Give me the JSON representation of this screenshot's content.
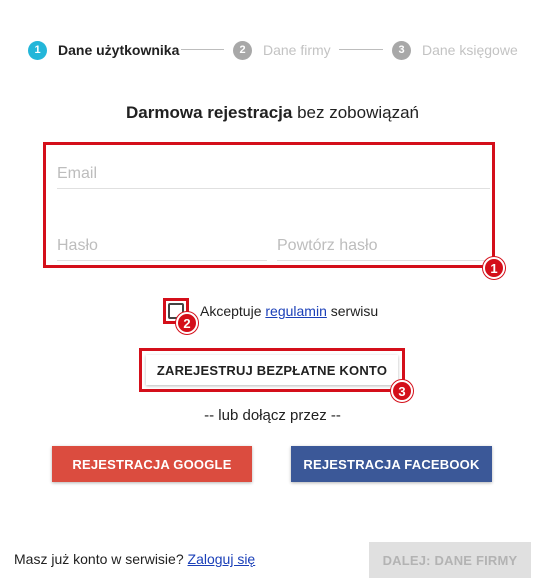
{
  "stepper": {
    "steps": [
      {
        "number": "1",
        "label": "Dane użytkownika",
        "state": "active"
      },
      {
        "number": "2",
        "label": "Dane firmy",
        "state": "inactive"
      },
      {
        "number": "3",
        "label": "Dane księgowe",
        "state": "inactive"
      }
    ]
  },
  "title": {
    "bold": "Darmowa rejestracja",
    "rest": " bez zobowiązań"
  },
  "form": {
    "email_placeholder": "Email",
    "password_placeholder": "Hasło",
    "repeat_password_placeholder": "Powtórz hasło"
  },
  "annotations": {
    "badge1": "1",
    "badge2": "2",
    "badge3": "3"
  },
  "terms": {
    "prefix": "Akceptuje ",
    "link": "regulamin",
    "suffix": " serwisu"
  },
  "register_button": "ZAREJESTRUJ BEZPŁATNE KONTO",
  "or_text": "-- lub dołącz przez --",
  "social": {
    "google": "REJESTRACJA GOOGLE",
    "facebook": "REJESTRACJA FACEBOOK"
  },
  "footer": {
    "text": "Masz już konto w serwisie? ",
    "login_link": "Zaloguj się",
    "next_button": "DALEJ: DANE FIRMY"
  },
  "colors": {
    "accent": "#23b6d9",
    "highlight": "#d40f1a",
    "google": "#db4c3f",
    "facebook": "#3b5898"
  }
}
